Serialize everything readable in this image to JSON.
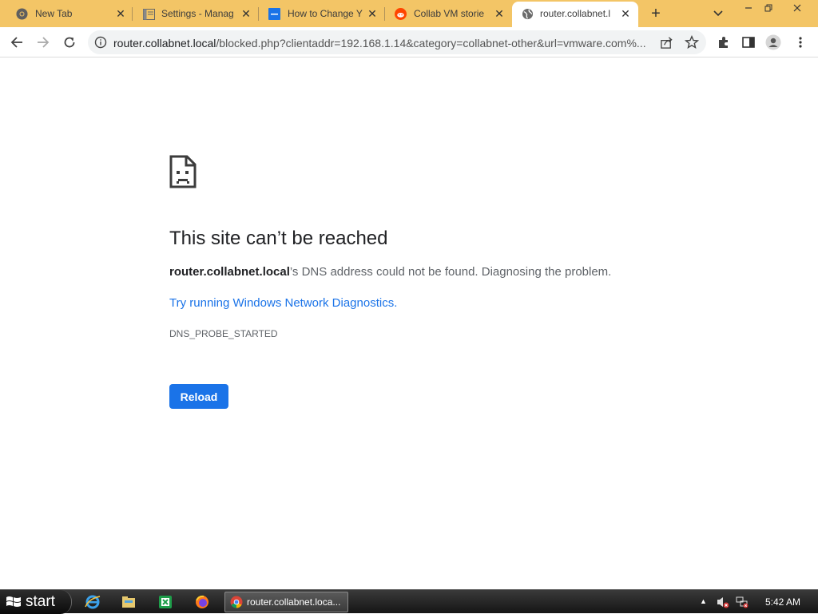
{
  "tabs": [
    {
      "title": "New Tab",
      "icon": "chrome-icon"
    },
    {
      "title": "Settings - Manag",
      "icon": "settings-page-icon"
    },
    {
      "title": "How to Change Y",
      "icon": "blue-page-icon"
    },
    {
      "title": "Collab VM storie",
      "icon": "reddit-icon"
    },
    {
      "title": "router.collabnet.l",
      "icon": "globe-icon"
    }
  ],
  "toolbar": {
    "url_host": "router.collabnet.local",
    "url_rest": "/blocked.php?clientaddr=192.168.1.14&category=collabnet-other&url=vmware.com%..."
  },
  "error": {
    "title": "This site can’t be reached",
    "host": "router.collabnet.local",
    "desc": "’s DNS address could not be found. Diagnosing the problem.",
    "link": "Try running Windows Network Diagnostics.",
    "code": "DNS_PROBE_STARTED",
    "reload_label": "Reload"
  },
  "taskbar": {
    "start_label": "start",
    "active_window": "router.collabnet.loca...",
    "clock": "5:42 AM"
  },
  "colors": {
    "tabstrip": "#f3c566",
    "accent": "#1a73e8"
  }
}
